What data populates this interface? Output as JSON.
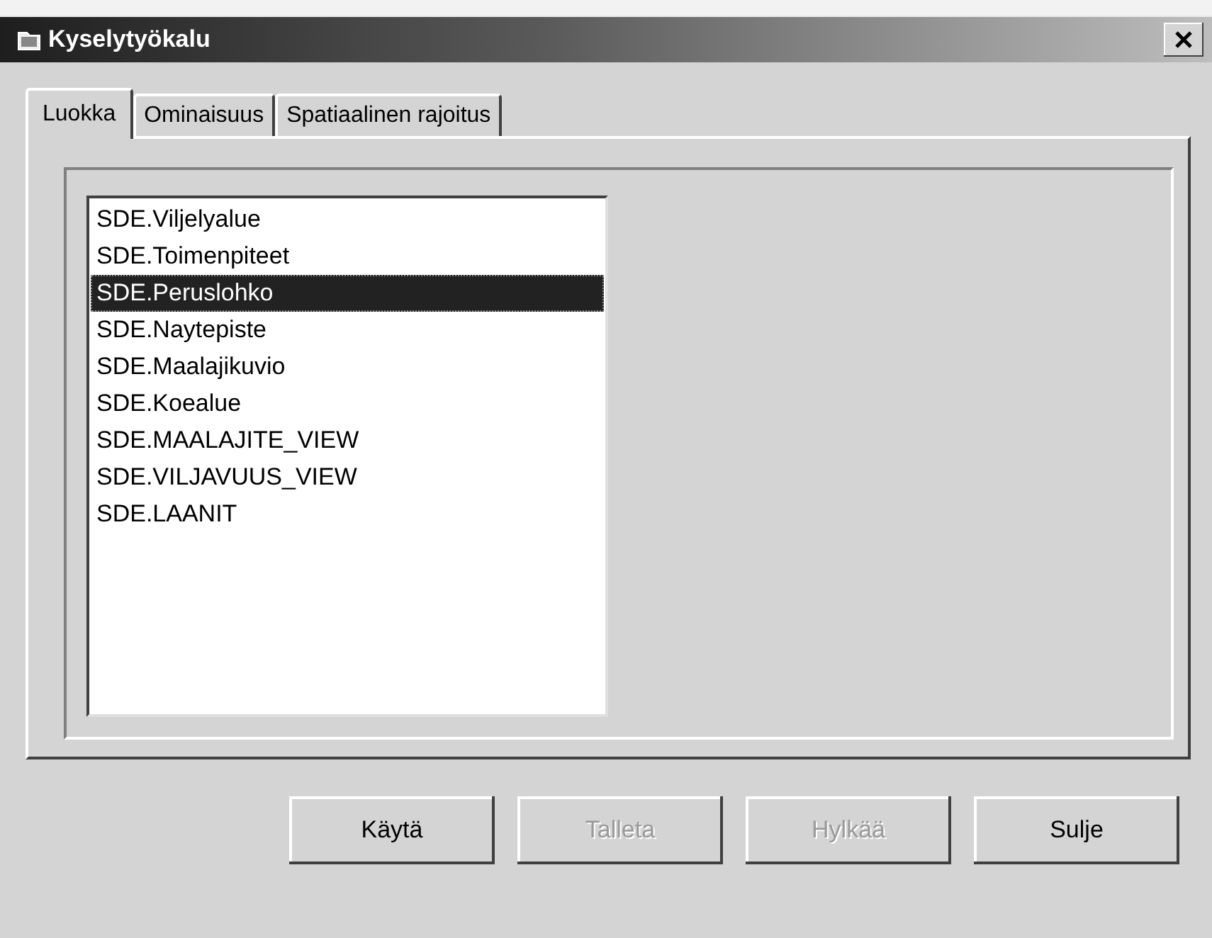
{
  "window": {
    "title": "Kyselytyökalu"
  },
  "tabs": [
    {
      "label": "Luokka",
      "selected": true
    },
    {
      "label": "Ominaisuus",
      "selected": false
    },
    {
      "label": "Spatiaalinen rajoitus",
      "selected": false
    }
  ],
  "list": {
    "items": [
      {
        "label": "SDE.Viljelyalue",
        "selected": false
      },
      {
        "label": "SDE.Toimenpiteet",
        "selected": false
      },
      {
        "label": "SDE.Peruslohko",
        "selected": true
      },
      {
        "label": "SDE.Naytepiste",
        "selected": false
      },
      {
        "label": "SDE.Maalajikuvio",
        "selected": false
      },
      {
        "label": "SDE.Koealue",
        "selected": false
      },
      {
        "label": "SDE.MAALAJITE_VIEW",
        "selected": false
      },
      {
        "label": "SDE.VILJAVUUS_VIEW",
        "selected": false
      },
      {
        "label": "SDE.LAANIT",
        "selected": false
      }
    ]
  },
  "buttons": [
    {
      "label": "Käytä",
      "disabled": false
    },
    {
      "label": "Talleta",
      "disabled": true
    },
    {
      "label": "Hylkää",
      "disabled": true
    },
    {
      "label": "Sulje",
      "disabled": false
    }
  ]
}
